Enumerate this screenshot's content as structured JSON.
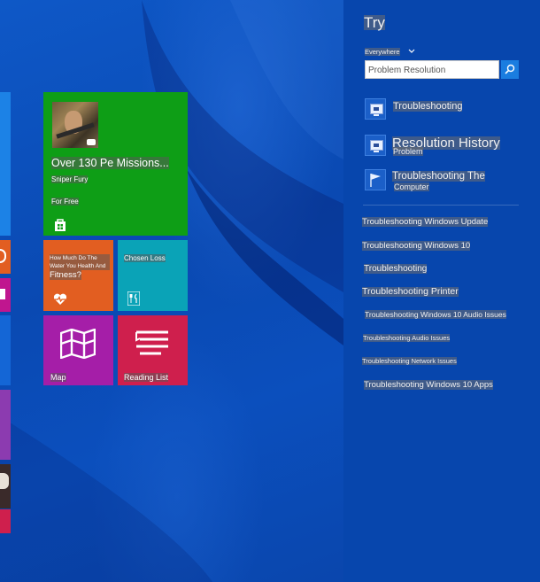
{
  "search_pane": {
    "title": "Try",
    "scope": "Everywhere",
    "search_value": "Problem Resolution",
    "top_results": [
      {
        "title": "Troubleshooting",
        "subtitle": ""
      },
      {
        "title": "Resolution History",
        "subtitle": "Problem"
      },
      {
        "title": "Troubleshooting The",
        "subtitle": "Computer"
      }
    ],
    "suggestions": [
      "Troubleshooting Windows Update",
      "Troubleshooting Windows 10",
      "Troubleshooting",
      "Troubleshooting Printer",
      "Troubleshooting Windows 10 Audio Issues",
      "Troubleshooting Audio Issues",
      "Troubleshooting Network Issues",
      "Troubleshooting Windows 10 Apps"
    ]
  },
  "tiles": {
    "store": {
      "headline": "Over 130 Pe Missions...",
      "game_name": "Sniper Fury",
      "price": "For Free",
      "icon": "store-bag-icon"
    },
    "health": {
      "text": "How Much Do The Water You Health And",
      "label": "Fitness?",
      "icon": "heart-pulse-icon"
    },
    "food": {
      "label": "Chosen Loss",
      "icon": "fork-knife-icon"
    },
    "maps": {
      "label": "Map",
      "icon": "map-icon"
    },
    "reading": {
      "label": "Reading List",
      "icon": "reading-list-icon"
    }
  },
  "colors": {
    "start_background": "#0b4fbd",
    "search_pane": "#0746ad",
    "store_tile": "#0e9e16",
    "health_tile": "#e25e21",
    "food_tile": "#0aa3b7",
    "maps_tile": "#a51ea8",
    "reading_tile": "#cf1f4d",
    "search_button": "#1a7de0"
  }
}
